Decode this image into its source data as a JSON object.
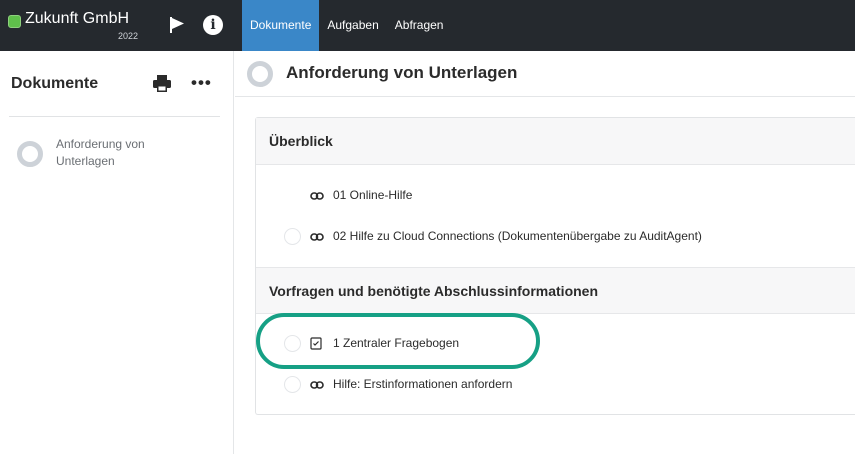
{
  "app": {
    "brand_name": "Zukunft GmbH",
    "brand_year": "2022",
    "brand_color": "#5fbf4b",
    "accent_color": "#3a87c8",
    "highlight_color": "#16a085"
  },
  "topbar": {
    "icons": [
      "flag-icon",
      "info-icon"
    ],
    "info_glyph": "i",
    "tabs": [
      {
        "label": "Dokumente",
        "active": true
      },
      {
        "label": "Aufgaben",
        "active": false
      },
      {
        "label": "Abfragen",
        "active": false
      }
    ]
  },
  "sidebar": {
    "title": "Dokumente",
    "actions": [
      "print-icon",
      "more-icon"
    ],
    "more_glyph": "•••",
    "items": [
      {
        "label": "Anforderung von Unterlagen",
        "icon": "progress-ring-icon"
      }
    ]
  },
  "main": {
    "title": "Anforderung von Unterlagen",
    "sections": [
      {
        "title": "Überblick",
        "items": [
          {
            "label": "01 Online-Hilfe",
            "icon": "link-icon",
            "has_radio": false
          },
          {
            "label": "02 Hilfe zu Cloud Connections (Dokumentenübergabe zu AuditAgent)",
            "icon": "link-icon",
            "has_radio": true
          }
        ]
      },
      {
        "title": "Vorfragen und benötigte Abschlussinformationen",
        "items": [
          {
            "label": "1 Zentraler Fragebogen",
            "icon": "questionnaire-icon",
            "has_radio": true,
            "highlighted": true
          },
          {
            "label": "Hilfe: Erstinformationen anfordern",
            "icon": "link-icon",
            "has_radio": true
          }
        ]
      }
    ]
  }
}
